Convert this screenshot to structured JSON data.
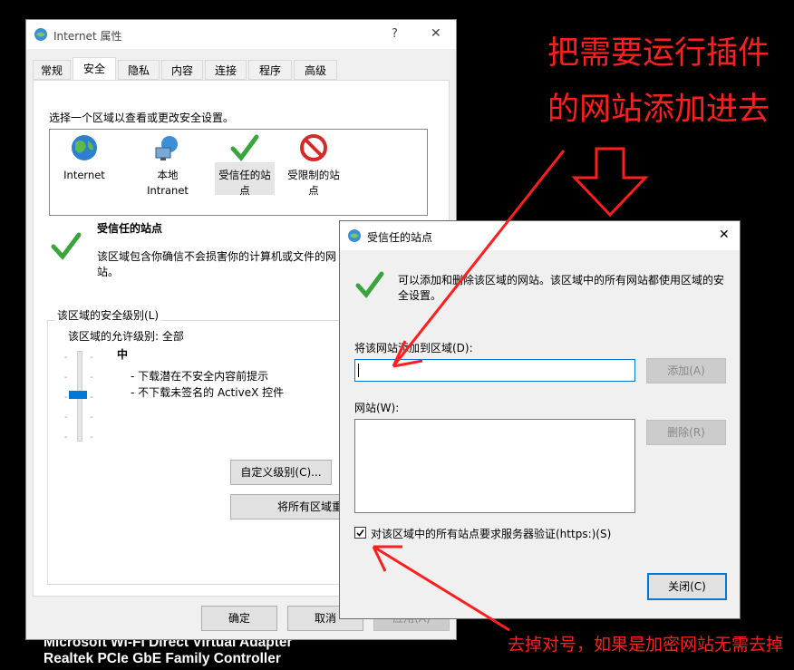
{
  "main_window": {
    "title": "Internet 属性",
    "help_glyph": "?",
    "close_glyph": "✕",
    "tabs": [
      "常规",
      "安全",
      "隐私",
      "内容",
      "连接",
      "程序",
      "高级"
    ],
    "instruction": "选择一个区域以查看或更改安全设置。",
    "zones": [
      {
        "label_line1": "Internet",
        "label_line2": "",
        "icon": "globe-icon"
      },
      {
        "label_line1": "本地",
        "label_line2": "Intranet",
        "icon": "network-icon"
      },
      {
        "label_line1": "受信任的站",
        "label_line2": "点",
        "icon": "check-icon"
      },
      {
        "label_line1": "受限制的站",
        "label_line2": "点",
        "icon": "restricted-icon"
      }
    ],
    "selected_zone": {
      "title": "受信任的站点",
      "description_line1": "该区域包含你确信不会损害你的计算机或文件的网",
      "description_line2": "站。"
    },
    "security_level": {
      "group_title": "该区域的安全级别(L)",
      "allowed": "该区域的允许级别: 全部",
      "level_name": "中",
      "bullets": [
        "- 下载潜在不安全内容前提示",
        "- 不下载未签名的 ActiveX 控件"
      ],
      "custom_button": "自定义级别(C)...",
      "reset_button": "将所有区域重置为"
    },
    "footer_buttons": {
      "ok": "确定",
      "cancel": "取消",
      "apply": "应用(A)"
    }
  },
  "dialog": {
    "title": "受信任的站点",
    "close_glyph": "✕",
    "info_line1": "可以添加和删除该区域的网站。该区域中的所有网站都使用区域的安",
    "info_line2": "全设置。",
    "add_label": "将该网站添加到区域(D):",
    "add_value": "",
    "add_button": "添加(A)",
    "sites_label": "网站(W):",
    "sites": [],
    "remove_button": "删除(R)",
    "https_checkbox_label": "对该区域中的所有站点要求服务器验证(https:)(S)",
    "https_checked": true,
    "close_button": "关闭(C)"
  },
  "annotations": {
    "top_line1": "把需要运行插件",
    "top_line2": "的网站添加进去",
    "bottom": "去掉对号，如果是加密网站无需去掉",
    "color": "#ff1f1f"
  },
  "background_text": {
    "line1": "Microsoft Wi-Fi Direct Virtual Adapter",
    "line2": "Realtek PCIe GbE Family Controller"
  }
}
